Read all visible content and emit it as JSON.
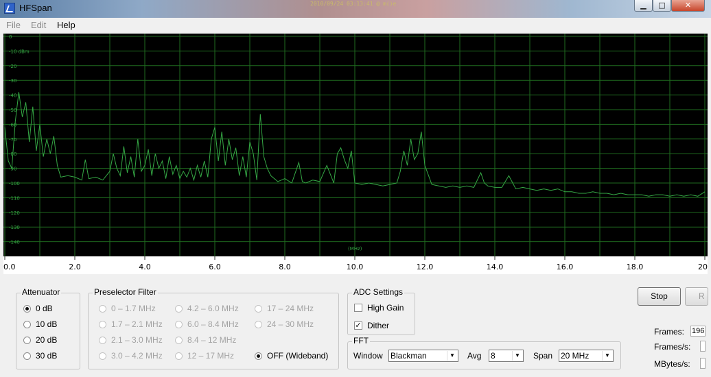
{
  "window": {
    "title": "HFSpan",
    "stamp": "2010/09/24 03:13:41 @ m()e",
    "minimize": "▁",
    "maximize": "□",
    "close": "✕"
  },
  "menu": {
    "file": "File",
    "edit": "Edit",
    "help": "Help"
  },
  "chart_data": {
    "type": "line",
    "xlabel": "(MHz)",
    "ylabel": "",
    "xlim": [
      0,
      20
    ],
    "ylim": [
      -150,
      0
    ],
    "background": "#000000",
    "grid_color": "#1f6b1f",
    "trace_color": "#35a845",
    "grid": true,
    "x_ticks": [
      "0.0",
      "2.0",
      "4.0",
      "6.0",
      "8.0",
      "10.0",
      "12.0",
      "14.0",
      "16.0",
      "18.0",
      "20"
    ],
    "y_ticks": [
      "0",
      "-10 dBm",
      "-20",
      "-30",
      "-40",
      "-50",
      "-60",
      "-70",
      "-80",
      "-90",
      "-100",
      "-110",
      "-120",
      "-130",
      "-140"
    ],
    "y_tick_values": [
      0,
      -10,
      -20,
      -30,
      -40,
      -50,
      -60,
      -70,
      -80,
      -90,
      -100,
      -110,
      -120,
      -130,
      -140
    ],
    "series": [
      {
        "x": [
          0.0,
          0.1,
          0.2,
          0.3,
          0.4,
          0.5,
          0.6,
          0.7,
          0.8,
          0.9,
          1.0,
          1.1,
          1.2,
          1.3,
          1.4,
          1.5,
          1.6,
          1.8,
          2.0,
          2.2,
          2.3,
          2.4,
          2.6,
          2.8,
          3.0,
          3.1,
          3.2,
          3.3,
          3.4,
          3.5,
          3.6,
          3.7,
          3.8,
          3.9,
          4.0,
          4.1,
          4.2,
          4.3,
          4.4,
          4.5,
          4.6,
          4.7,
          4.8,
          4.9,
          5.0,
          5.1,
          5.2,
          5.3,
          5.4,
          5.5,
          5.6,
          5.7,
          5.8,
          5.9,
          6.0,
          6.1,
          6.2,
          6.3,
          6.4,
          6.5,
          6.6,
          6.7,
          6.8,
          6.9,
          7.0,
          7.1,
          7.2,
          7.3,
          7.4,
          7.5,
          7.6,
          7.8,
          8.0,
          8.2,
          8.4,
          8.5,
          8.6,
          8.8,
          9.0,
          9.2,
          9.4,
          9.5,
          9.6,
          9.7,
          9.8,
          9.9,
          10.0,
          10.2,
          10.4,
          10.6,
          10.8,
          11.0,
          11.2,
          11.3,
          11.4,
          11.5,
          11.6,
          11.7,
          11.8,
          11.9,
          12.0,
          12.2,
          12.4,
          12.6,
          12.8,
          13.0,
          13.2,
          13.4,
          13.6,
          13.7,
          13.8,
          14.0,
          14.2,
          14.4,
          14.6,
          14.8,
          15.0,
          15.2,
          15.4,
          15.6,
          15.8,
          16.0,
          16.2,
          16.4,
          16.6,
          16.8,
          17.0,
          17.2,
          17.4,
          17.6,
          17.8,
          18.0,
          18.2,
          18.4,
          18.6,
          18.8,
          19.0,
          19.2,
          19.4,
          19.6,
          19.8,
          20.0
        ],
        "y": [
          -62,
          -85,
          -90,
          -58,
          -38,
          -55,
          -45,
          -72,
          -48,
          -78,
          -60,
          -82,
          -70,
          -80,
          -68,
          -88,
          -96,
          -95,
          -96,
          -98,
          -84,
          -97,
          -96,
          -98,
          -92,
          -80,
          -90,
          -95,
          -75,
          -93,
          -82,
          -96,
          -70,
          -92,
          -88,
          -77,
          -95,
          -80,
          -90,
          -85,
          -97,
          -82,
          -94,
          -88,
          -97,
          -92,
          -96,
          -90,
          -98,
          -88,
          -96,
          -85,
          -96,
          -70,
          -62,
          -85,
          -65,
          -88,
          -70,
          -84,
          -76,
          -95,
          -82,
          -96,
          -72,
          -80,
          -98,
          -53,
          -82,
          -90,
          -95,
          -99,
          -97,
          -100,
          -86,
          -99,
          -100,
          -98,
          -99,
          -88,
          -100,
          -80,
          -76,
          -84,
          -90,
          -78,
          -100,
          -101,
          -100,
          -101,
          -102,
          -101,
          -100,
          -92,
          -78,
          -88,
          -70,
          -84,
          -80,
          -65,
          -88,
          -101,
          -102,
          -103,
          -102,
          -103,
          -102,
          -103,
          -93,
          -100,
          -102,
          -103,
          -103,
          -95,
          -104,
          -103,
          -104,
          -105,
          -104,
          -105,
          -104,
          -106,
          -106,
          -107,
          -107,
          -106,
          -107,
          -107,
          -108,
          -107,
          -108,
          -108,
          -108,
          -109,
          -108,
          -108,
          -109,
          -108,
          -109,
          -108,
          -109,
          -106
        ]
      }
    ]
  },
  "attenuator": {
    "title": "Attenuator",
    "options": [
      "0 dB",
      "10 dB",
      "20 dB",
      "30 dB"
    ],
    "selected": "0 dB"
  },
  "preselector": {
    "title": "Preselector Filter",
    "col1": [
      "0 – 1.7 MHz",
      "1.7 – 2.1 MHz",
      "2.1 – 3.0 MHz",
      "3.0 – 4.2 MHz"
    ],
    "col2": [
      "4.2 – 6.0 MHz",
      "6.0 – 8.4 MHz",
      "8.4 – 12 MHz",
      "12 – 17 MHz"
    ],
    "col3": [
      "17 – 24 MHz",
      "24 – 30 MHz"
    ],
    "wideband": "OFF (Wideband)",
    "selected": "OFF (Wideband)"
  },
  "adc": {
    "title": "ADC Settings",
    "high_gain": "High Gain",
    "high_gain_checked": false,
    "dither": "Dither",
    "dither_checked": true
  },
  "fft": {
    "title": "FFT",
    "window_label": "Window",
    "window_value": "Blackman",
    "avg_label": "Avg",
    "avg_value": "8",
    "span_label": "Span",
    "span_value": "20 MHz"
  },
  "controls": {
    "stop": "Stop",
    "r": "R"
  },
  "stats": {
    "frames_label": "Frames:",
    "frames_value": "196",
    "fps_label": "Frames/s:",
    "fps_value": "",
    "mbs_label": "MBytes/s:",
    "mbs_value": ""
  }
}
